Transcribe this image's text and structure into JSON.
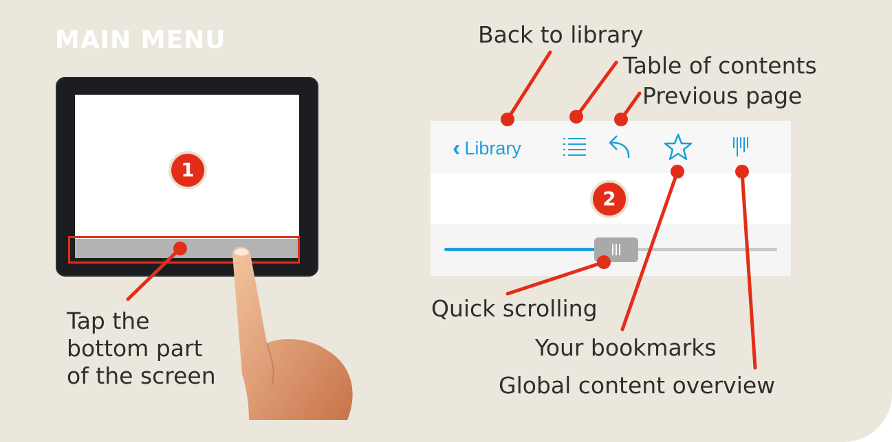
{
  "heading": "MAIN MENU",
  "step_badges": [
    "1",
    "2"
  ],
  "tap_instruction": [
    "Tap the",
    "bottom part",
    "of the screen"
  ],
  "toolbar": {
    "back_label": "Library",
    "icons": [
      "chevron-left-icon",
      "list-icon",
      "undo-arrow-icon",
      "star-icon",
      "page-overview-icon"
    ]
  },
  "slider": {
    "progress": 0.48
  },
  "callouts": {
    "back_to_library": "Back to library",
    "table_of_contents": "Table of contents",
    "previous_page": "Previous page",
    "quick_scrolling": "Quick scrolling",
    "your_bookmarks": "Your bookmarks",
    "global_overview": "Global content overview"
  },
  "colors": {
    "background": "#ece7dc",
    "accent_red": "#e42d18",
    "link_blue": "#1aa0db"
  }
}
